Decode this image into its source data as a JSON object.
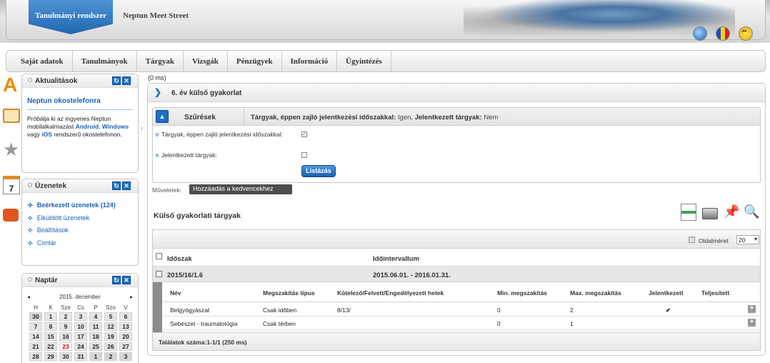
{
  "header": {
    "brand": "Tanulmányi rendszer",
    "site_name": "Neptun Meet Street"
  },
  "menu": [
    "Saját adatok",
    "Tanulmányok",
    "Tárgyak",
    "Vizsgák",
    "Pénzügyek",
    "Információ",
    "Ügyintézés"
  ],
  "sidebar": {
    "news": {
      "title": "Aktualitások",
      "headline": "Neptun okostelefonra",
      "body_pre": "Próbálja ki az ingyenes Neptun mobilalkalmazást ",
      "android": "Android",
      "sep": ",",
      "windows": "Windows",
      "body_mid": " vagy ",
      "ios": "iOS",
      "body_post": " rendszerű okostelefonon."
    },
    "messages": {
      "title": "Üzenetek",
      "items": [
        "Beérkezett üzenetek (124)",
        "Elküldött üzenetek",
        "Beállítások",
        "Címtár"
      ]
    },
    "calendar": {
      "title": "Naptár",
      "prev": "◂",
      "next": "▸",
      "month_label": "2015. december",
      "weekdays": [
        "H",
        "K",
        "Sze",
        "Cs",
        "P",
        "Szo",
        "V"
      ],
      "weeks": [
        [
          "30",
          "1",
          "2",
          "3",
          "4",
          "5",
          "6"
        ],
        [
          "7",
          "8",
          "9",
          "10",
          "11",
          "12",
          "13"
        ],
        [
          "14",
          "15",
          "16",
          "17",
          "18",
          "19",
          "20"
        ],
        [
          "21",
          "22",
          "23",
          "24",
          "25",
          "26",
          "27"
        ],
        [
          "28",
          "29",
          "30",
          "31",
          "1",
          "2",
          "3"
        ]
      ]
    }
  },
  "main": {
    "timing": "(0 ms)",
    "page_title": "6. év külső gyakorlat",
    "filter": {
      "title": "Szűrések",
      "summary_label1": "Tárgyak, éppen zajló jelentkezési időszakkal:",
      "summary_value1": " Igen, ",
      "summary_label2": "Jelentkezett tárgyak:",
      "summary_value2": " Nem",
      "option1": "Tárgyak, éppen zajló jelentkezési időszakkal:",
      "option1_check": "✓",
      "option2": "Jelentkezett tárgyak:",
      "list_button": "Listázás"
    },
    "actions_label": "Műveletek:",
    "favorites_button": "Hozzáadás a kedvencekhez",
    "section_title": "Külső gyakorlati tárgyak",
    "grid": {
      "page_size_label": "Oldalméret",
      "page_size": "20",
      "group_headers": {
        "period": "Időszak",
        "interval": "Időintervallum"
      },
      "group": {
        "period": "2015/16/1.6",
        "interval": "2015.06.01. - 2016.01.31."
      },
      "columns": {
        "name": "Név",
        "type": "Megszakítás típus",
        "weeks": "Kötelező/Felvett/Engedélyezett hetek",
        "min": "Min. megszakítás",
        "max": "Max. megszakítás",
        "registered": "Jelentkezett",
        "completed": "Teljesített"
      },
      "rows": [
        {
          "name": "Belgyógyászat",
          "type": "Csak időben",
          "weeks": "8/13/",
          "min": "0",
          "max": "2",
          "registered": "✔"
        },
        {
          "name": "Sebészet - traumatológia",
          "type": "Csak térben",
          "weeks": "",
          "min": "0",
          "max": "1",
          "registered": ""
        }
      ],
      "footer": "Találatok száma:1-1/1 (250 ms)"
    }
  },
  "colors": {
    "accent": "#1d6fc7",
    "menu_bg": "#e5e5e5",
    "check_green": "#2f9b1c"
  },
  "icons": {
    "header": [
      "globe-icon",
      "flag-icon",
      "smiley-icon"
    ],
    "rail": [
      "favorites-icon",
      "messages-icon",
      "star-icon",
      "calendar-icon",
      "chat-icon"
    ],
    "tools": [
      "excel-export-icon",
      "print-icon",
      "pin-icon",
      "search-icon"
    ]
  }
}
